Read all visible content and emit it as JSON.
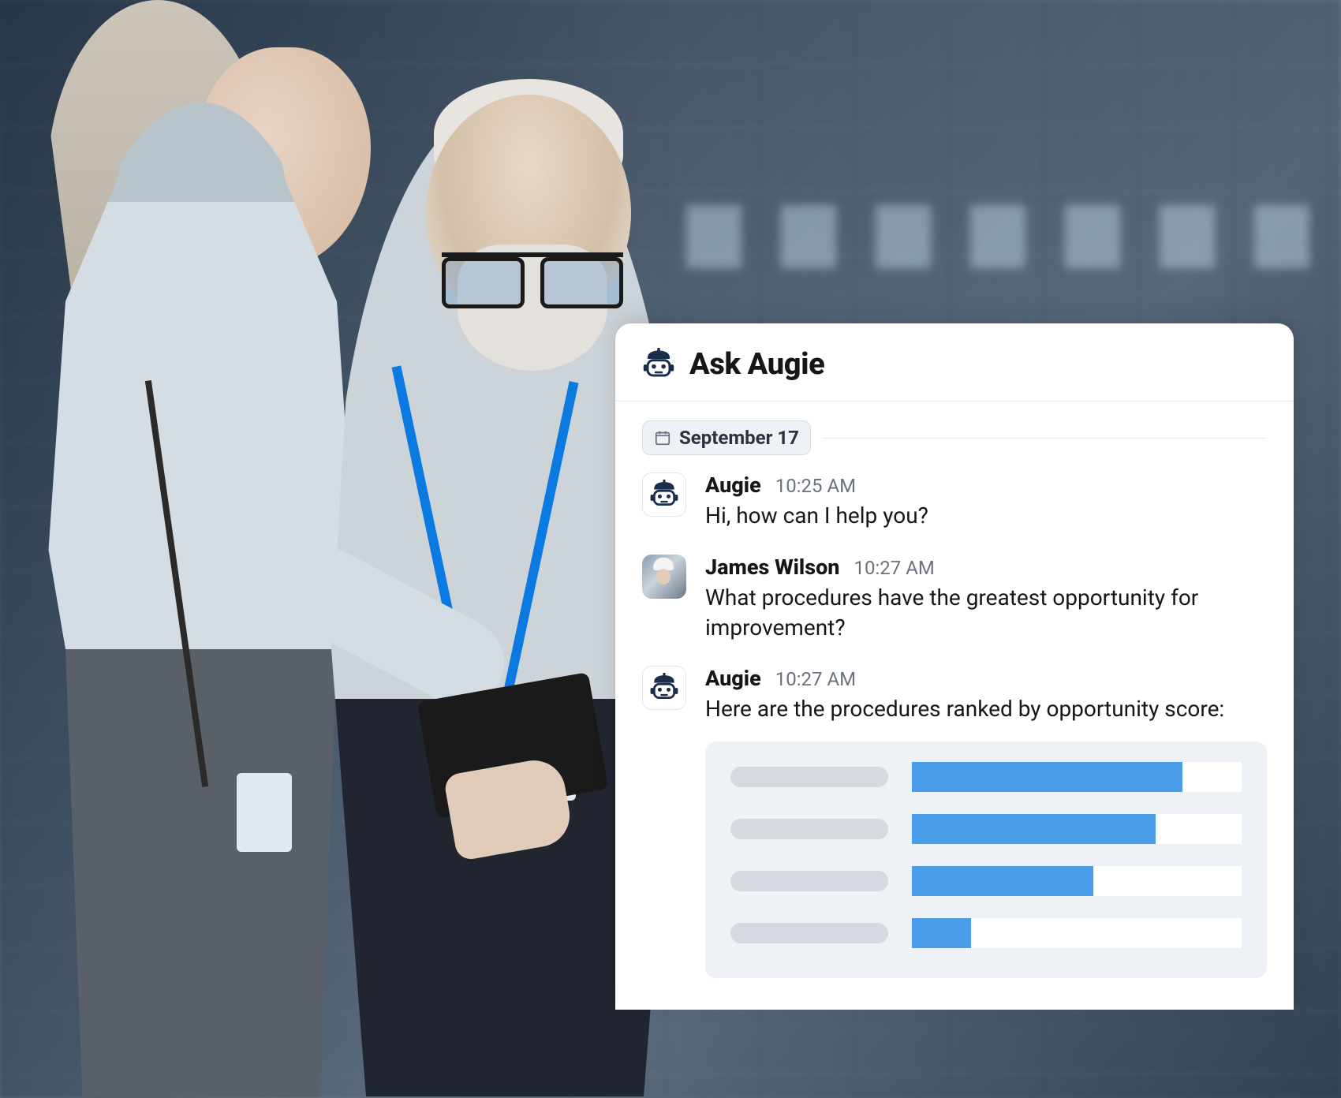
{
  "panel": {
    "title": "Ask Augie",
    "date_label": "September 17"
  },
  "messages": [
    {
      "sender": "Augie",
      "time": "10:25 AM",
      "avatar_type": "augie",
      "text": "Hi, how can I help you?"
    },
    {
      "sender": "James Wilson",
      "time": "10:27 AM",
      "avatar_type": "user",
      "text": "What procedures have the greatest opportunity for improvement?"
    },
    {
      "sender": "Augie",
      "time": "10:27 AM",
      "avatar_type": "augie",
      "text": "Here are the procedures ranked by opportunity score:"
    }
  ],
  "chart_data": {
    "type": "bar",
    "title": "Procedures ranked by opportunity score",
    "categories": [
      "",
      "",
      "",
      ""
    ],
    "values": [
      82,
      74,
      55,
      18
    ],
    "xlabel": "",
    "ylabel": "",
    "ylim": [
      0,
      100
    ]
  }
}
